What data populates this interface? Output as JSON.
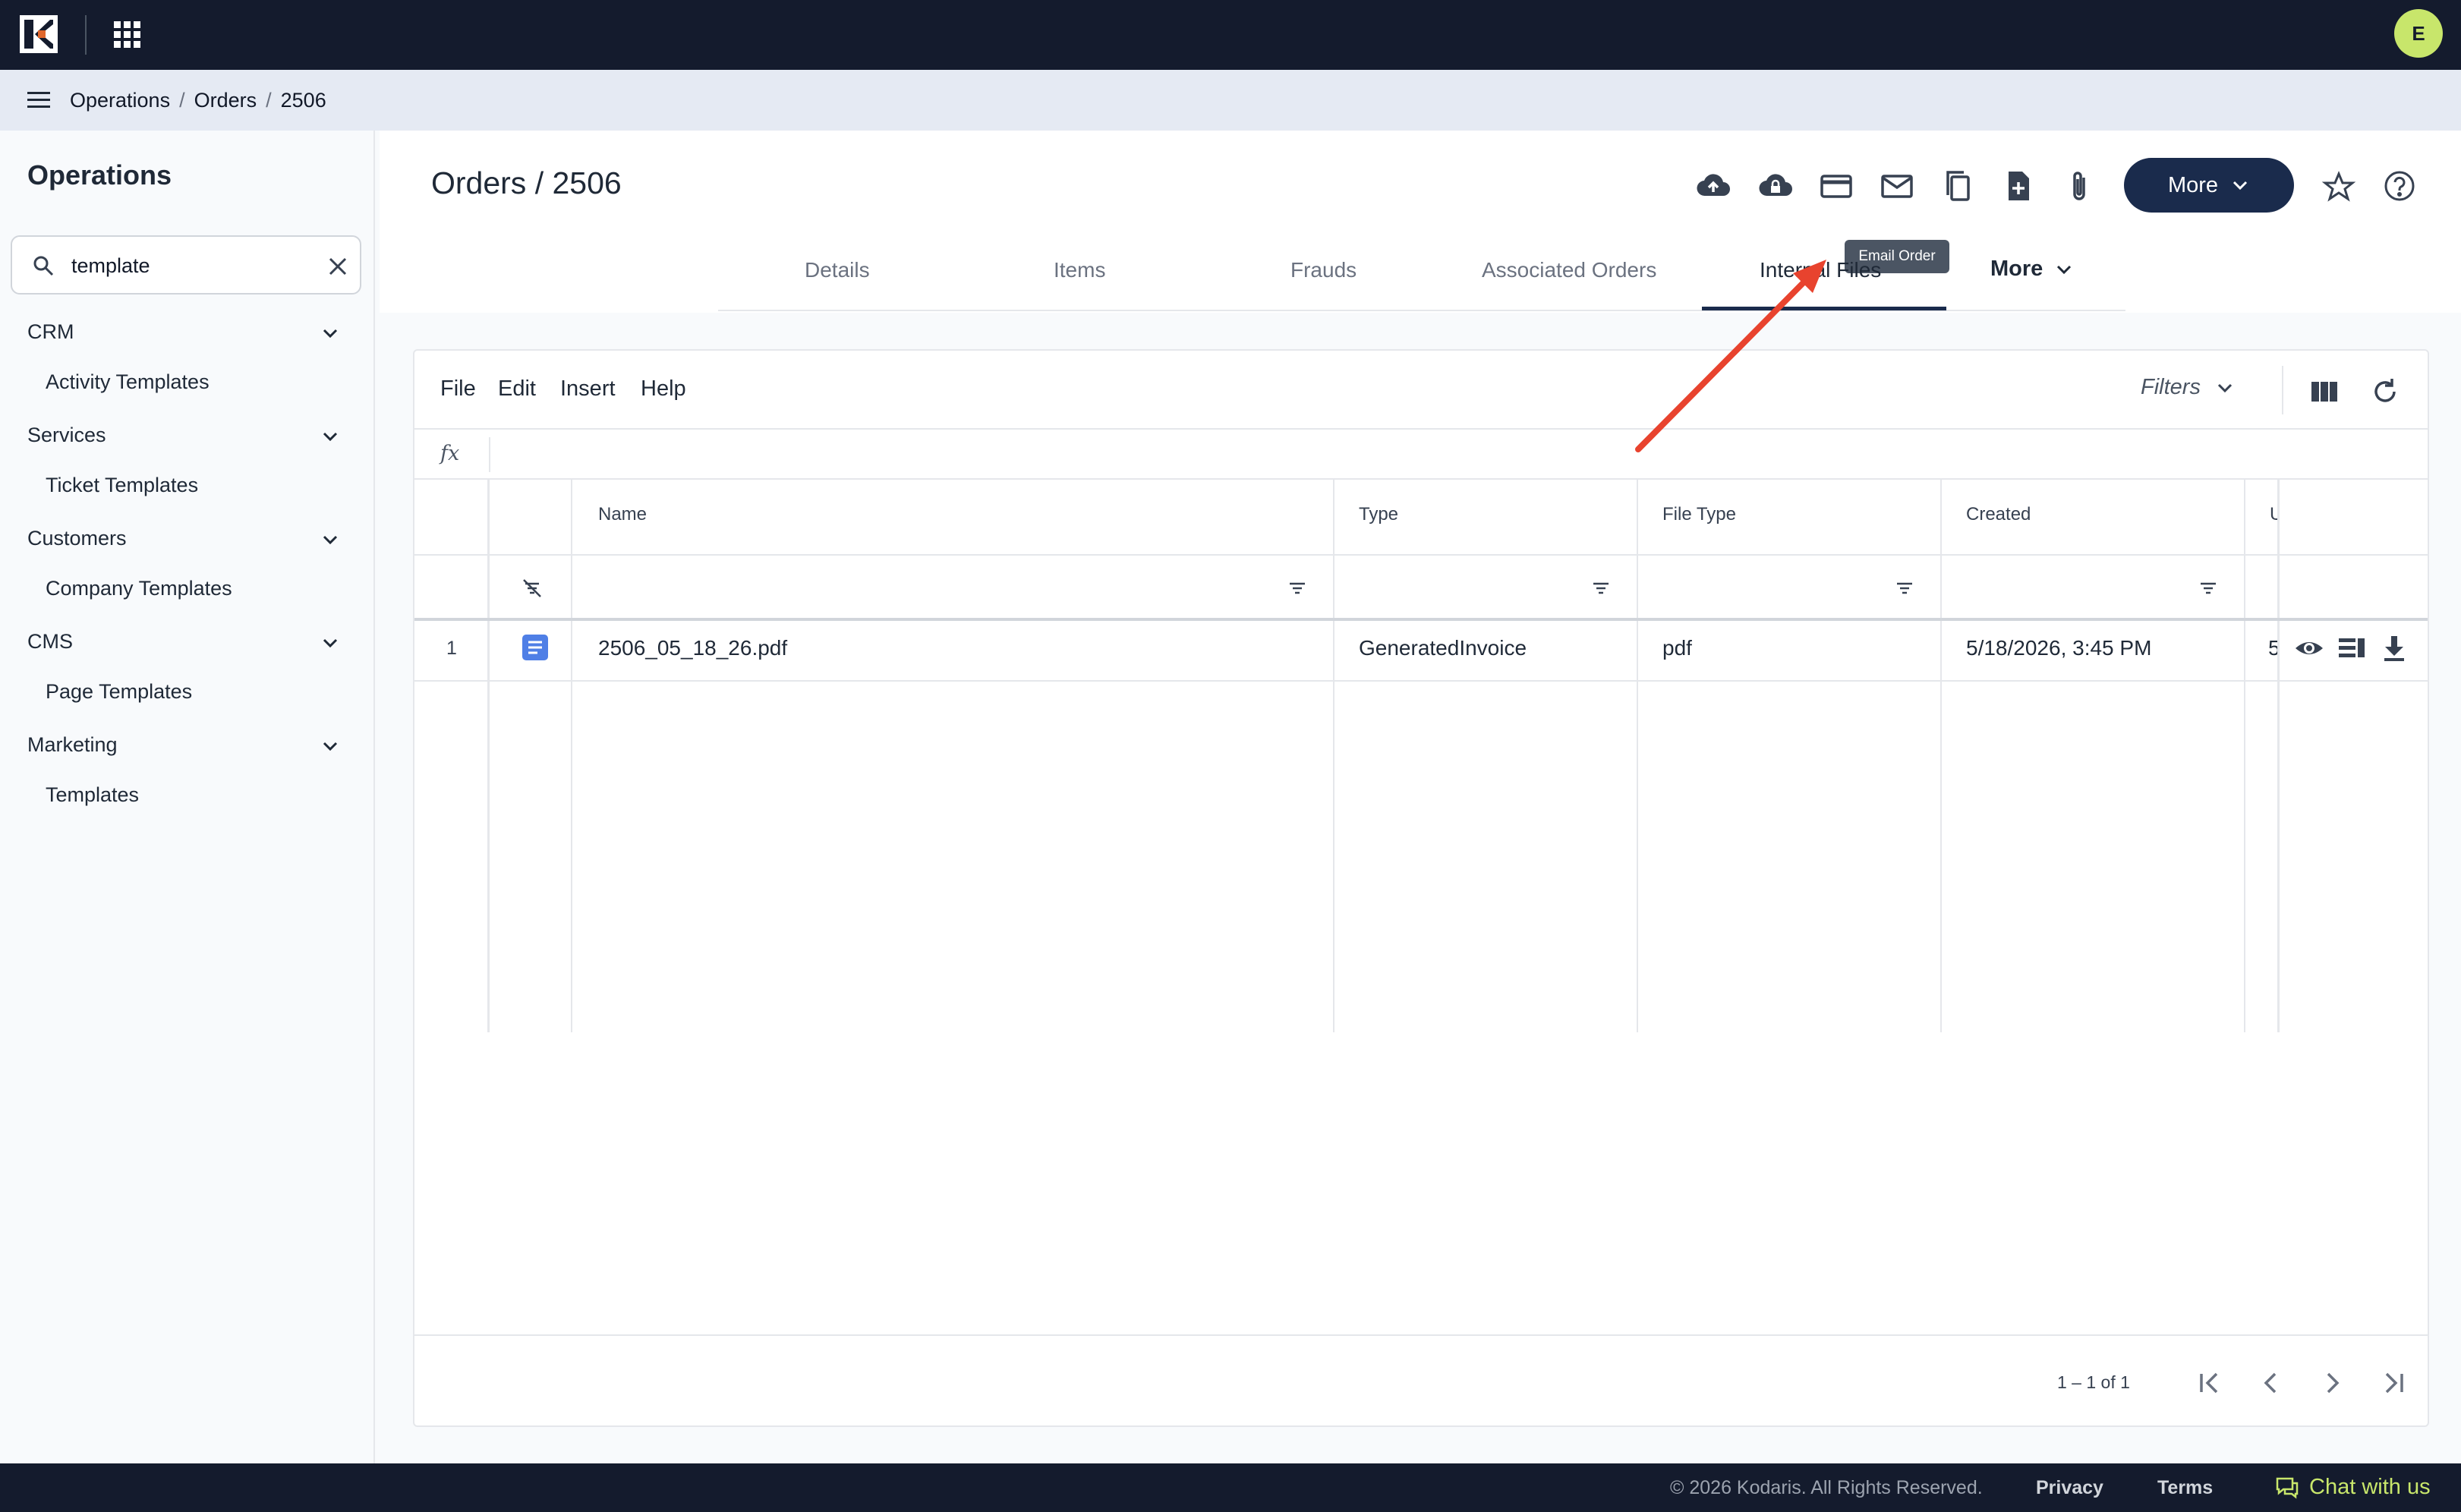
{
  "topbar": {
    "avatar_initial": "E"
  },
  "breadcrumb": {
    "items": [
      "Operations",
      "Orders",
      "2506"
    ],
    "separator": "/"
  },
  "sidebar": {
    "title": "Operations",
    "search": {
      "value": "template",
      "placeholder": ""
    },
    "groups": [
      {
        "label": "CRM",
        "items": [
          "Activity Templates"
        ]
      },
      {
        "label": "Services",
        "items": [
          "Ticket Templates"
        ]
      },
      {
        "label": "Customers",
        "items": [
          "Company Templates"
        ]
      },
      {
        "label": "CMS",
        "items": [
          "Page Templates"
        ]
      },
      {
        "label": "Marketing",
        "items": [
          "Templates"
        ]
      }
    ]
  },
  "main": {
    "title": "Orders / 2506",
    "more_button": "More",
    "tooltip": "Email Order",
    "toolbar_icons": [
      "cloud-upload-icon",
      "cloud-lock-icon",
      "credit-card-icon",
      "email-icon",
      "copy-icon",
      "add-document-icon",
      "attachment-icon",
      "star-icon",
      "help-icon"
    ],
    "tabs": [
      "Details",
      "Items",
      "Frauds",
      "Associated Orders",
      "Internal Files"
    ],
    "active_tab": "Internal Files",
    "tabs_more": "More"
  },
  "grid": {
    "menu": [
      "File",
      "Edit",
      "Insert",
      "Help"
    ],
    "filters_label": "Filters",
    "fx_label": "fx",
    "columns": [
      "Name",
      "Type",
      "File Type",
      "Created",
      "U"
    ],
    "rows": [
      {
        "num": "1",
        "name": "2506_05_18_26.pdf",
        "type": "GeneratedInvoice",
        "file_type": "pdf",
        "created": "5/18/2026, 3:45 PM",
        "extra": "5"
      }
    ],
    "pager": "1 – 1 of 1"
  },
  "footer": {
    "copyright": "© 2026 Kodaris. All Rights Reserved.",
    "privacy": "Privacy",
    "terms": "Terms",
    "chat": "Chat with us"
  },
  "colors": {
    "navy": "#141b2d",
    "accent": "#1a2b4c",
    "lime": "#c8e66b",
    "annotation": "#e8432e"
  }
}
